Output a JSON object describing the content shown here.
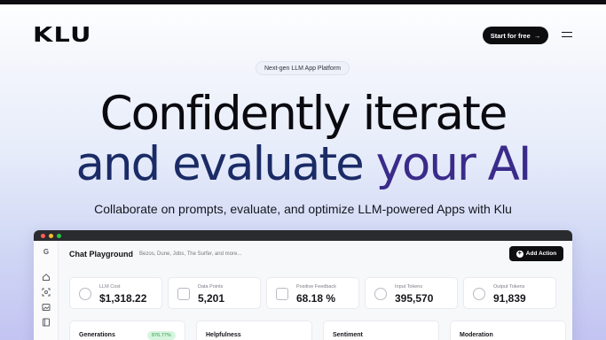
{
  "brand": {
    "logo": "KLU"
  },
  "header": {
    "cta_label": "Start for free",
    "cta_arrow": "→"
  },
  "hero": {
    "pill": "Next-gen LLM App Platform",
    "line1": "Confidently iterate",
    "line2_a": "and evaluate ",
    "line2_b": "your AI",
    "subtitle": "Collaborate on prompts, evaluate, and optimize LLM-powered Apps with Klu"
  },
  "app": {
    "title": "Chat Playground",
    "subtitle": "Bezos, Dune, Jobs, The Surfer, and more...",
    "action_label": "Add Action",
    "sidebar_logo": "G",
    "stats": [
      {
        "label": "LLM Cost",
        "value": "$1,318.22"
      },
      {
        "label": "Data Points",
        "value": "5,201"
      },
      {
        "label": "Positive Feedback",
        "value": "68.18 %"
      },
      {
        "label": "Input Tokens",
        "value": "395,570"
      },
      {
        "label": "Output Tokens",
        "value": "91,839"
      }
    ],
    "panels": [
      {
        "title": "Generations",
        "badge": "876.77%"
      },
      {
        "title": "Helpfulness"
      },
      {
        "title": "Sentiment"
      },
      {
        "title": "Moderation"
      }
    ]
  },
  "colors": {
    "window_dot_red": "#ff5f57",
    "window_dot_yellow": "#febc2e",
    "window_dot_green": "#28c840",
    "headline_accent": "#3a2b8a"
  }
}
